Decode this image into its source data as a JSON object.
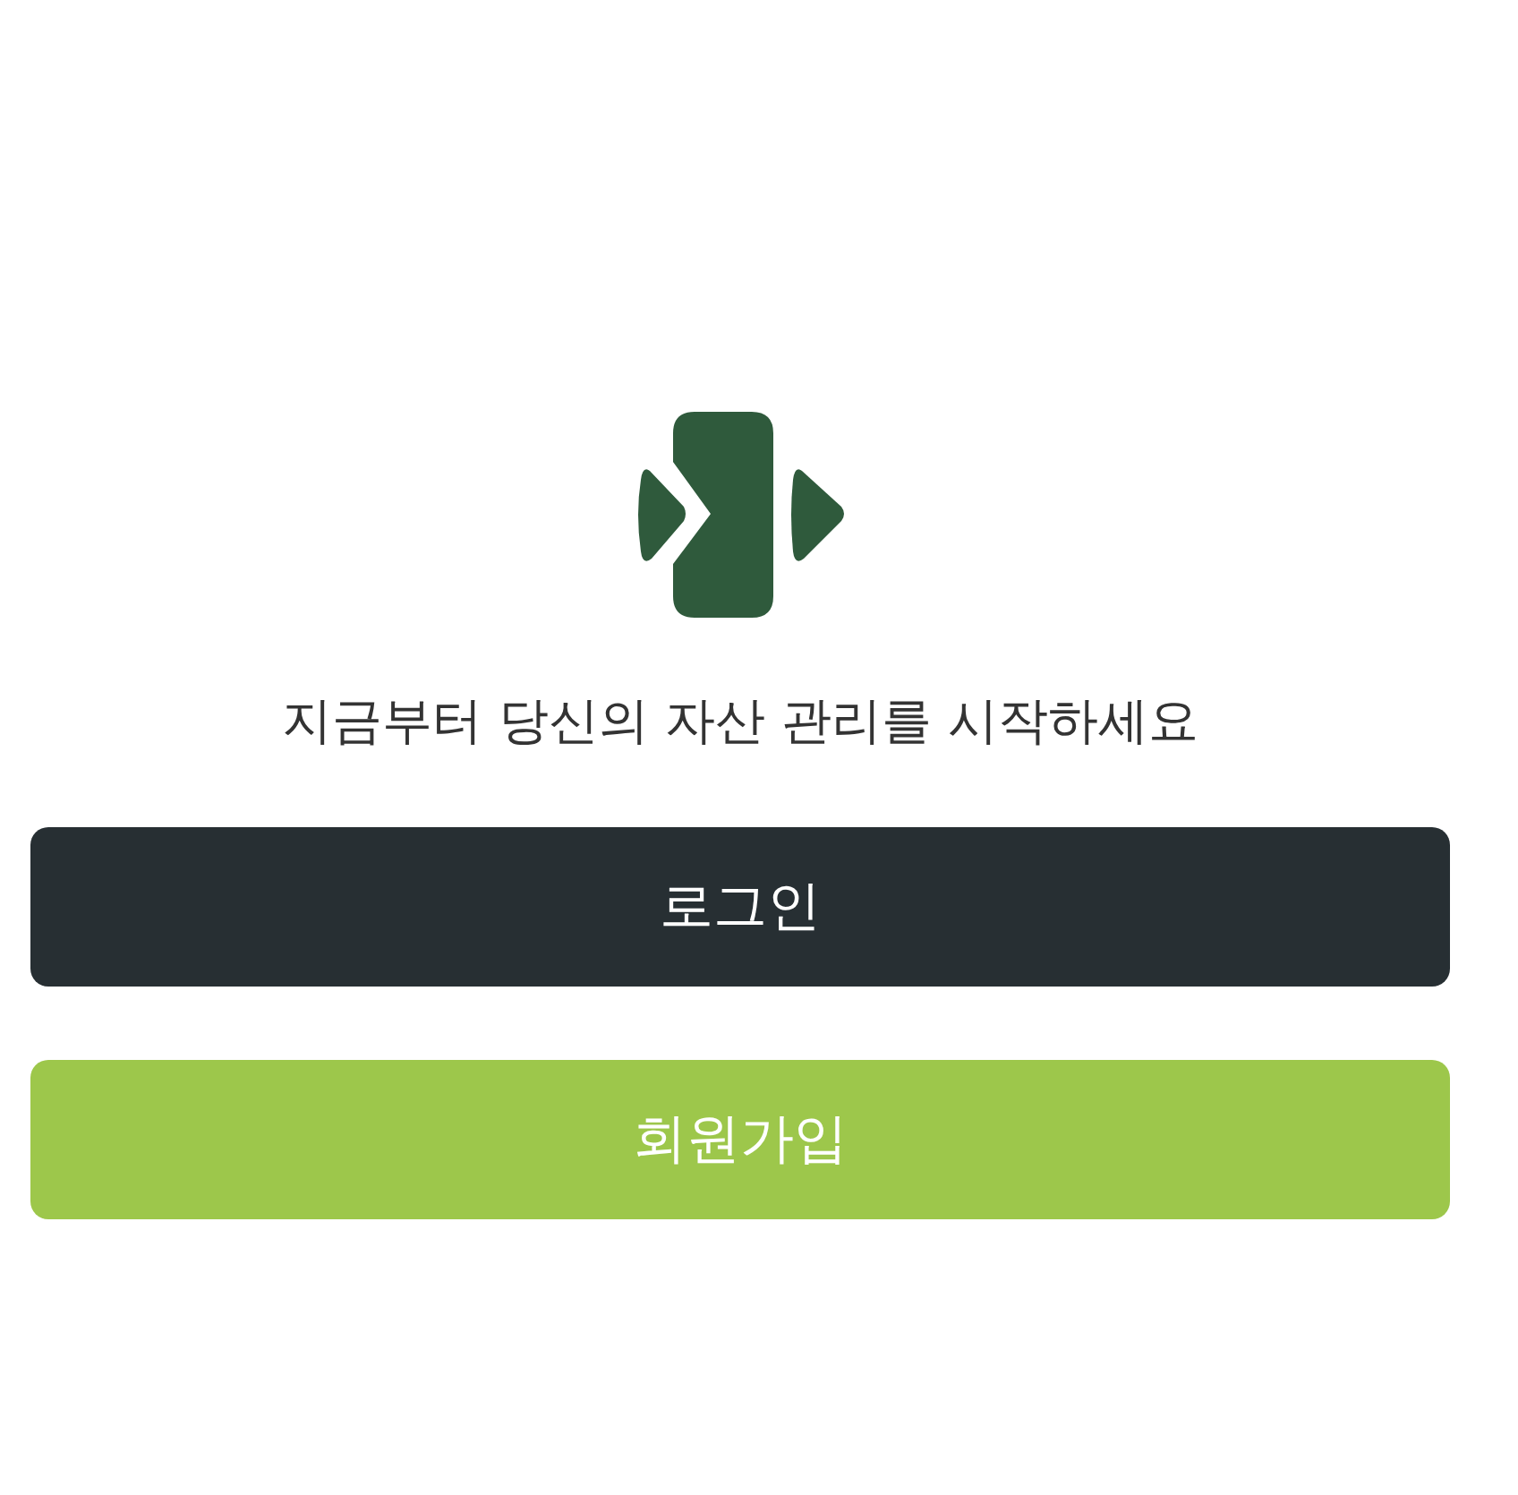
{
  "tagline": "지금부터 당신의 자산 관리를 시작하세요",
  "buttons": [
    {
      "label": "로그인",
      "kind": "dark"
    },
    {
      "label": "회원가입",
      "kind": "accent"
    }
  ]
}
